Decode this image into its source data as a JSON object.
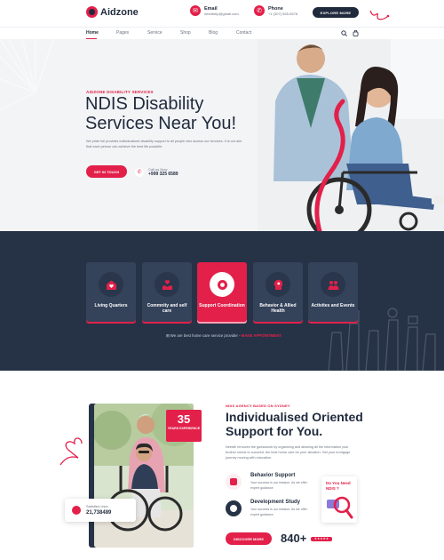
{
  "header": {
    "logo_text": "Aidzone",
    "email_label": "Email",
    "email_value": "needhelp@gmail.com",
    "phone_label": "Phone",
    "phone_value": "+1 (307) 555-0678",
    "explore_button": "EXPLORE MORE"
  },
  "nav": {
    "items": [
      "Home",
      "Pages",
      "Service",
      "Shop",
      "Blog",
      "Contact"
    ],
    "active": "Home"
  },
  "hero": {
    "kicker": "AIDZONE DISABILITY SERVICES",
    "title": "NDIS Disability Services Near You!",
    "description": "We pride full provides individualised disability support to all people who access our services. It is our aim that each person can achieve the best life possible.",
    "button": "GET IN TOUCH",
    "call_label": "Call us Now",
    "call_value": "+999 325 6589"
  },
  "services": {
    "cards": [
      {
        "title": "Living Quarters",
        "icon": "home-heart-icon",
        "active": false
      },
      {
        "title": "Commnity and self care",
        "icon": "hands-heart-icon",
        "active": false
      },
      {
        "title": "Support Coordination",
        "icon": "support-icon",
        "active": true
      },
      {
        "title": "Behavior & Allied Health",
        "icon": "head-icon",
        "active": false
      },
      {
        "title": "Activites and Events",
        "icon": "people-icon",
        "active": false
      }
    ],
    "note_prefix": "We are best home care service provider -",
    "note_link": "MAKE APPOINTMENT"
  },
  "about": {
    "years_number": "35",
    "years_label": "YEARS EXPERIENCE",
    "satisfied_label": "Satisfied User",
    "satisfied_value": "21,738489",
    "kicker": "NDIS AGENCY BASED ON SYDNEY",
    "title": "Individualised Oriented Support for You.",
    "description": "Needle removes the guesswork by organizing and allowing all the information your brother needs to succeed, the best home care for your situation. Get your mortgage journey moving with education.",
    "features": [
      {
        "title": "Behavior Support",
        "text": "Your success is our mission. As we offer expert guidance",
        "icon": "behavior-support-icon"
      },
      {
        "title": "Development Study",
        "text": "Your success is our mission. As we offer expert guidance",
        "icon": "development-study-icon"
      }
    ],
    "need_label": "Do You Need NDIS ?",
    "discover_button": "DISCOVER MORE",
    "count": "840+",
    "rating": "★★★★★"
  },
  "colors": {
    "accent": "#e2204a",
    "dark": "#263347",
    "card": "#34425a",
    "hero_bg": "#f3f4f6"
  }
}
